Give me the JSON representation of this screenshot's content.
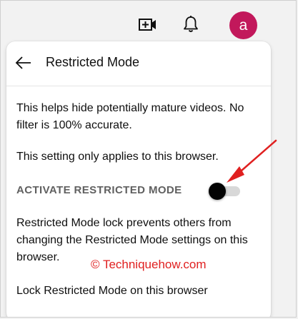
{
  "topbar": {
    "create_icon": "video-camera-plus-icon",
    "notifications_icon": "bell-icon",
    "avatar_letter": "a",
    "avatar_color": "#c2185b"
  },
  "panel": {
    "back_icon": "arrow-left-icon",
    "title": "Restricted Mode",
    "description": "This helps hide potentially mature videos. No filter is 100% accurate.",
    "browser_note": "This setting only applies to this browser.",
    "activate_label": "ACTIVATE RESTRICTED MODE",
    "activate_state": "off",
    "lock_description": "Restricted Mode lock prevents others from changing the Restricted Mode settings on this browser.",
    "lock_option": "Lock Restricted Mode on this browser"
  },
  "watermark": "© Techniquehow.com",
  "annotation_color": "#e02020",
  "toggle_knob_color": "#030303"
}
